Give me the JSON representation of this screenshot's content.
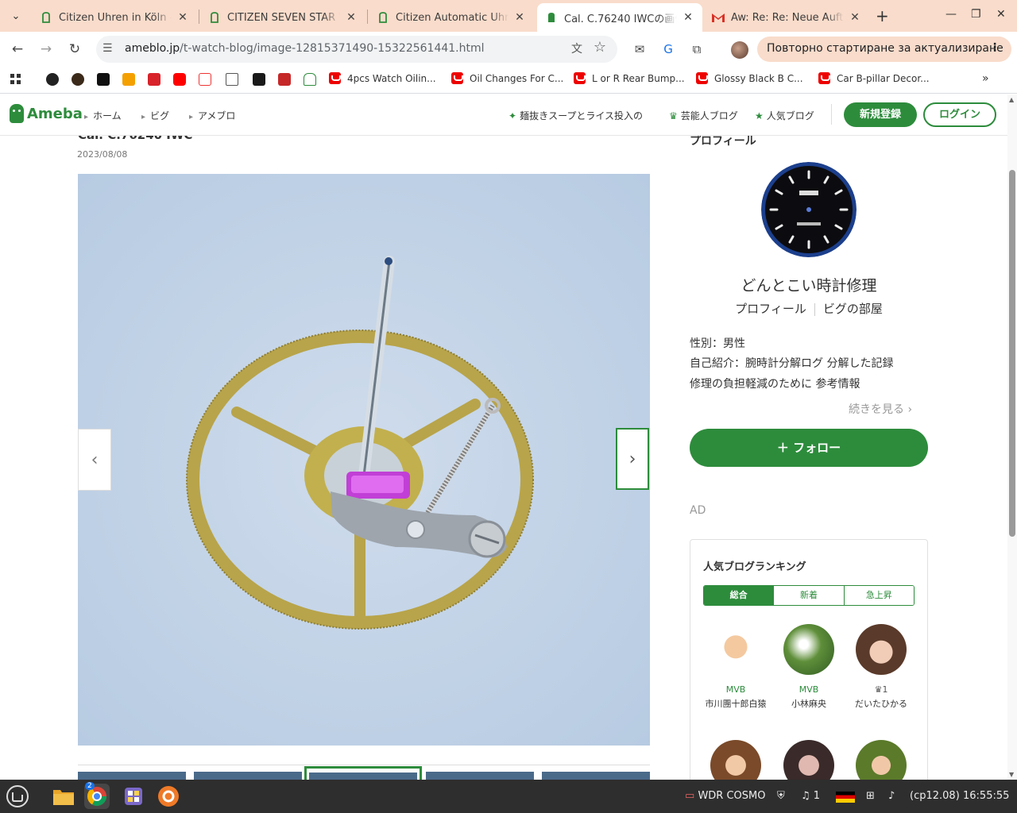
{
  "browser": {
    "tabs": [
      {
        "title": "Citizen Uhren in Köln - M",
        "active": false
      },
      {
        "title": "CITIZEN SEVEN STAR V2",
        "active": false
      },
      {
        "title": "Citizen Automatic Uhr m",
        "active": false
      },
      {
        "title": "Cal. C.76240 IWCの画像",
        "active": true
      },
      {
        "title": "Aw: Re:  Re: Neue Auftra",
        "active": false
      }
    ],
    "url_domain": "ameblo.jp",
    "url_path": "/t-watch-blog/image-12815371490-15322561441.html",
    "update_button": "Повторно стартиране за актуализиране",
    "bookmarks": [
      "4pcs Watch Oilin...",
      "Oil Changes For C...",
      "L or R Rear Bump...",
      "Glossy Black B C...",
      "Car B-pillar Decor..."
    ],
    "more_bookmarks": "»"
  },
  "ameba": {
    "logo": "Ameba",
    "nav": [
      "ホーム",
      "ビグ",
      "アメブロ"
    ],
    "trending": "麺抜きスープとライス投入の",
    "celebrity_blogs": "芸能人ブログ",
    "popular_blogs": "人気ブログ",
    "register": "新規登録",
    "login": "ログイン"
  },
  "post": {
    "title": "Cal. C.76240 IWC",
    "date": "2023/08/08",
    "prev_arrow": "‹",
    "next_arrow": "›"
  },
  "sidebar": {
    "heading": "プロフィール",
    "blog_name": "どんとこい時計修理",
    "profile_link": "プロフィール",
    "room_link": "ビグの部屋",
    "gender": "性別：男性",
    "intro_1": "自己紹介：腕時計分解ログ 分解した記録",
    "intro_2": "修理の負担軽減のために 参考情報",
    "more": "続きを見る",
    "follow": "フォロー",
    "ad": "AD",
    "ranking_title": "人気ブログランキング",
    "ranking_tabs": [
      "総合",
      "新着",
      "急上昇"
    ],
    "ranking_items": [
      {
        "badge": "MVB",
        "name": "市川團十郎白猿"
      },
      {
        "badge": "MVB",
        "name": "小林麻央"
      },
      {
        "badge": "1",
        "name": "だいたひかる"
      }
    ]
  },
  "taskbar": {
    "chrome_badge": "2",
    "radio": "WDR COSMO",
    "notifications": "1",
    "layout": "(cp12.08)",
    "time": "16:55:55"
  },
  "colors": {
    "tab_strip": "#f9dccb",
    "ameba_green": "#2d8c3c",
    "photo_bg": "#c5d6ea"
  }
}
